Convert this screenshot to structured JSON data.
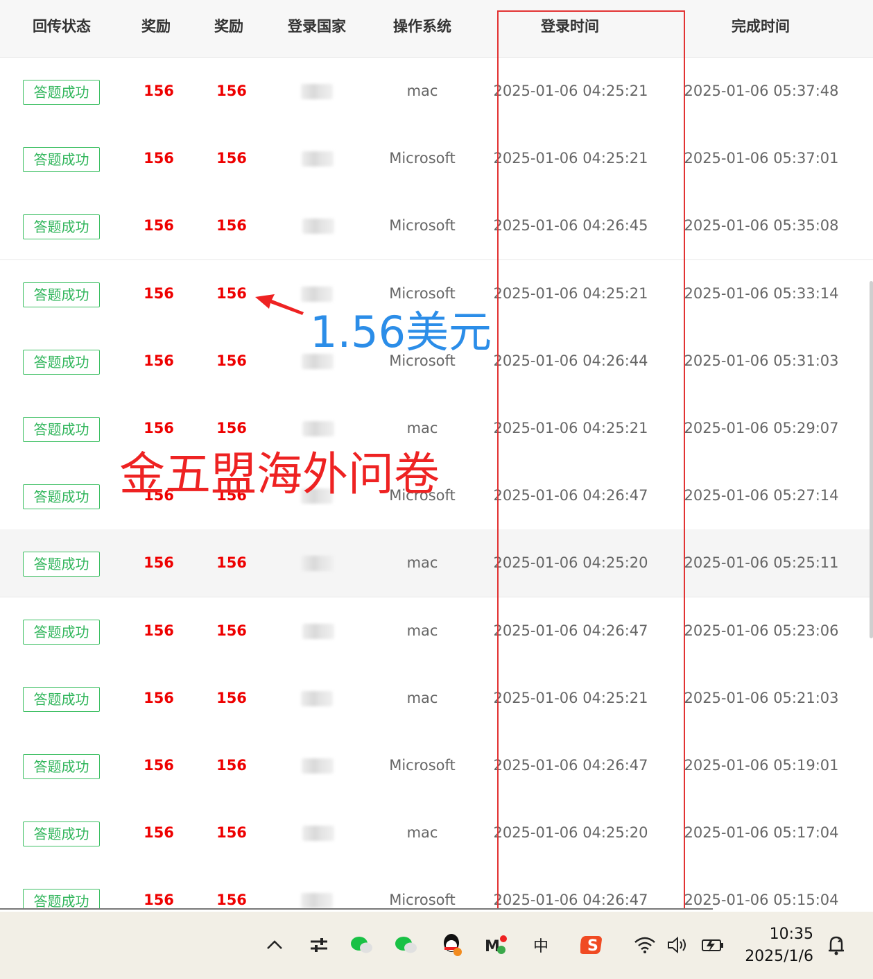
{
  "table": {
    "headers": [
      "回传状态",
      "奖励",
      "奖励",
      "登录国家",
      "操作系统",
      "登录时间",
      "完成时间"
    ],
    "rows": [
      {
        "status": "答题成功",
        "reward1": "156",
        "reward2": "156",
        "os": "mac",
        "login": "2025-01-06 04:25:21",
        "finish": "2025-01-06 05:37:48"
      },
      {
        "status": "答题成功",
        "reward1": "156",
        "reward2": "156",
        "os": "Microsoft",
        "login": "2025-01-06 04:25:21",
        "finish": "2025-01-06 05:37:01"
      },
      {
        "status": "答题成功",
        "reward1": "156",
        "reward2": "156",
        "os": "Microsoft",
        "login": "2025-01-06 04:26:45",
        "finish": "2025-01-06 05:35:08"
      },
      {
        "status": "答题成功",
        "reward1": "156",
        "reward2": "156",
        "os": "Microsoft",
        "login": "2025-01-06 04:25:21",
        "finish": "2025-01-06 05:33:14"
      },
      {
        "status": "答题成功",
        "reward1": "156",
        "reward2": "156",
        "os": "Microsoft",
        "login": "2025-01-06 04:26:44",
        "finish": "2025-01-06 05:31:03"
      },
      {
        "status": "答题成功",
        "reward1": "156",
        "reward2": "156",
        "os": "mac",
        "login": "2025-01-06 04:25:21",
        "finish": "2025-01-06 05:29:07"
      },
      {
        "status": "答题成功",
        "reward1": "156",
        "reward2": "156",
        "os": "Microsoft",
        "login": "2025-01-06 04:26:47",
        "finish": "2025-01-06 05:27:14"
      },
      {
        "status": "答题成功",
        "reward1": "156",
        "reward2": "156",
        "os": "mac",
        "login": "2025-01-06 04:25:20",
        "finish": "2025-01-06 05:25:11"
      },
      {
        "status": "答题成功",
        "reward1": "156",
        "reward2": "156",
        "os": "mac",
        "login": "2025-01-06 04:26:47",
        "finish": "2025-01-06 05:23:06"
      },
      {
        "status": "答题成功",
        "reward1": "156",
        "reward2": "156",
        "os": "mac",
        "login": "2025-01-06 04:25:21",
        "finish": "2025-01-06 05:21:03"
      },
      {
        "status": "答题成功",
        "reward1": "156",
        "reward2": "156",
        "os": "Microsoft",
        "login": "2025-01-06 04:26:47",
        "finish": "2025-01-06 05:19:01"
      },
      {
        "status": "答题成功",
        "reward1": "156",
        "reward2": "156",
        "os": "mac",
        "login": "2025-01-06 04:25:20",
        "finish": "2025-01-06 05:17:04"
      },
      {
        "status": "答题成功",
        "reward1": "156",
        "reward2": "156",
        "os": "Microsoft",
        "login": "2025-01-06 04:26:47",
        "finish": "2025-01-06 05:15:04"
      }
    ],
    "highlighted_row": 7
  },
  "annotations": {
    "blue_text": "1.56美元",
    "red_text": "金五盟海外问卷",
    "colors": {
      "blue": "#2b8de8",
      "red": "#ee2222",
      "box": "#e23333"
    }
  },
  "taskbar": {
    "icons": [
      "chevron-up-icon",
      "settings-sliders-icon",
      "wechat-icon",
      "wechat-icon",
      "qq-icon",
      "mail-icon",
      "ime-zhong-icon",
      "sogou-icon",
      "wifi-icon",
      "volume-icon",
      "battery-icon",
      "notification-icon"
    ],
    "ime_label": "中",
    "time": "10:35",
    "date": "2025/1/6"
  }
}
